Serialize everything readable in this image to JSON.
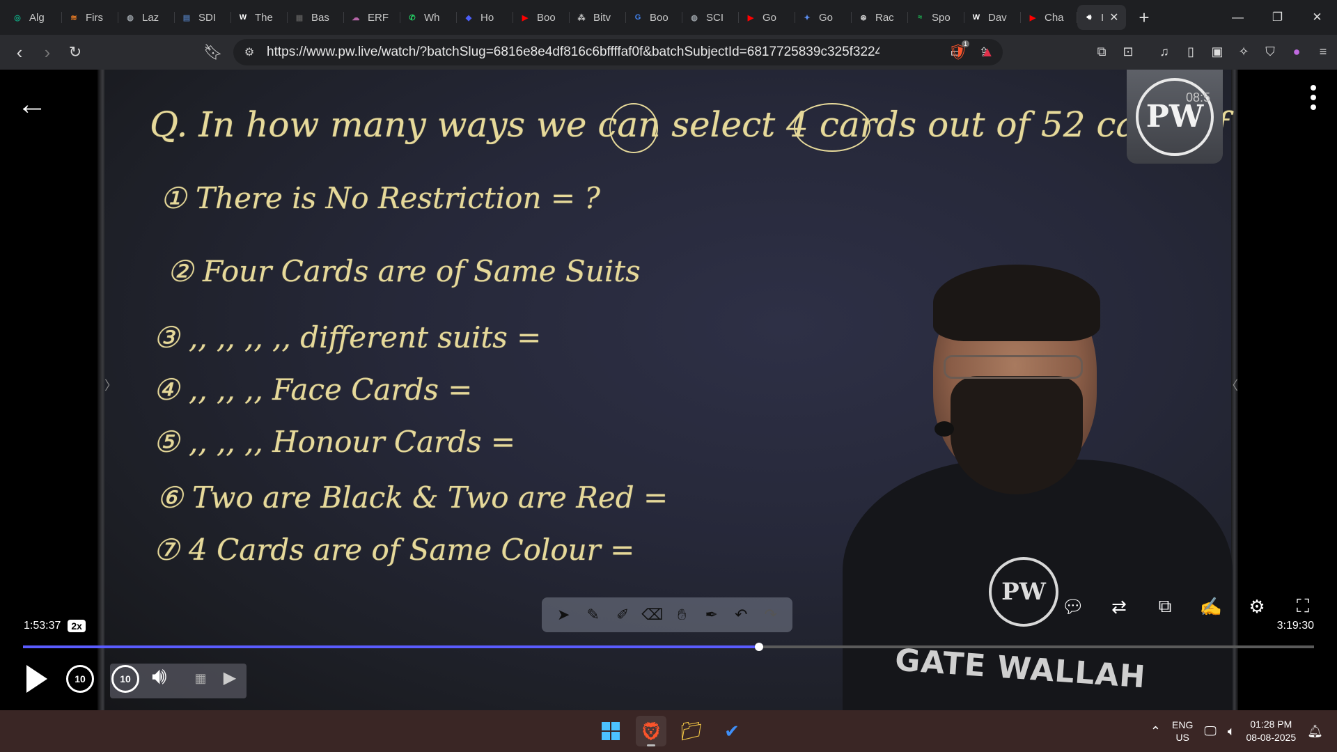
{
  "tabs": [
    {
      "title": "Alg",
      "icon": "chatgpt-icon",
      "color": "#10a37f"
    },
    {
      "title": "Firs",
      "icon": "stack-icon",
      "color": "#f48024"
    },
    {
      "title": "Laz",
      "icon": "globe-icon",
      "color": "#9aa0a6"
    },
    {
      "title": "SDI",
      "icon": "sdi-icon",
      "color": "#4a6fa5"
    },
    {
      "title": "The",
      "icon": "w3schools-icon",
      "color": "#ffffff"
    },
    {
      "title": "Bas",
      "icon": "grid-icon",
      "color": "#555555"
    },
    {
      "title": "ERF",
      "icon": "brain-icon",
      "color": "#b565a7"
    },
    {
      "title": "Wh",
      "icon": "whatsapp-icon",
      "color": "#25d366"
    },
    {
      "title": "Ho",
      "icon": "bookmark-icon",
      "color": "#4b5ef7"
    },
    {
      "title": "Boo",
      "icon": "youtube-icon",
      "color": "#ff0000"
    },
    {
      "title": "Bitv",
      "icon": "bitwise-icon",
      "color": "#cccccc"
    },
    {
      "title": "Boo",
      "icon": "google-icon",
      "color": "#4285f4"
    },
    {
      "title": "SCI",
      "icon": "globe-icon",
      "color": "#9aa0a6"
    },
    {
      "title": "Go",
      "icon": "youtube-icon",
      "color": "#ff0000"
    },
    {
      "title": "Go",
      "icon": "gemini-icon",
      "color": "#5b8def"
    },
    {
      "title": "Rac",
      "icon": "openai-icon",
      "color": "#dddddd"
    },
    {
      "title": "Spo",
      "icon": "spotify-icon",
      "color": "#1db954"
    },
    {
      "title": "Dav",
      "icon": "wikipedia-icon",
      "color": "#ffffff"
    },
    {
      "title": "Cha",
      "icon": "youtube-icon",
      "color": "#ff0000"
    }
  ],
  "active_tab": {
    "title": "I",
    "icon": "speaker-icon"
  },
  "address": {
    "url": "https://www.pw.live/watch/?batchSlug=6816e8e4df816c6bffffaf0f&batchSubjectId=6817725839c325f3224e28d...",
    "shield_count": "1"
  },
  "board": {
    "question": "Q. In how many ways we can select 4 cards out of 52 cards if",
    "lines": [
      "① There is No Restriction = ?",
      "② Four Cards are of Same Suits",
      "③  ,,     ,,      ,,   ,, different suits =",
      "④   ,,      ,,      ,,  Face Cards =",
      "⑤   ,,      ,,      ,,  Honour Cards =",
      "⑥ Two are Black & Two are Red =",
      "⑦  4 Cards are of Same Colour ="
    ],
    "logo_text": "PW",
    "logo_note": "08:5",
    "shirt_logo": "PW",
    "shirt_text": "GATE WALLAH"
  },
  "player": {
    "current_time": "1:53:37",
    "speed": "2x",
    "total_time": "3:19:30",
    "progress_fraction": 0.57,
    "skip_back": "10",
    "skip_fwd": "10",
    "accent": "#5a5cff"
  },
  "taskbar": {
    "lang_line1": "ENG",
    "lang_line2": "US",
    "time": "01:28 PM",
    "date": "08-08-2025"
  }
}
